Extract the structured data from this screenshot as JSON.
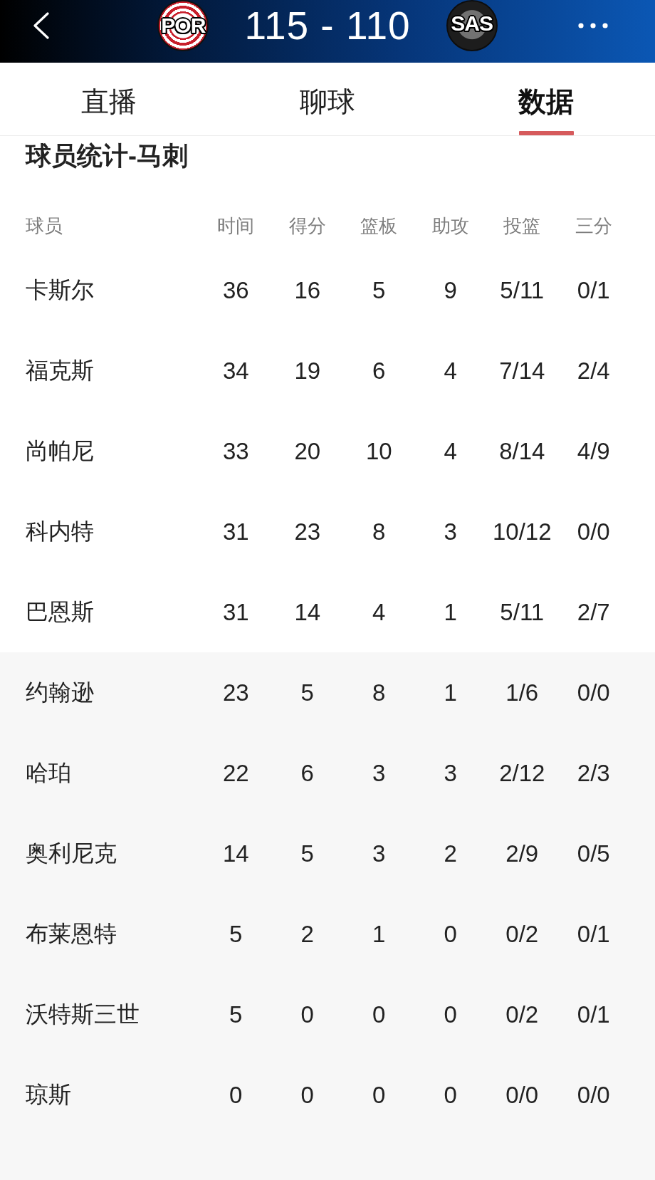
{
  "header": {
    "home": {
      "abbr": "POR"
    },
    "score": "115 - 110",
    "away": {
      "abbr": "SAS"
    }
  },
  "tabs": [
    {
      "label": "直播",
      "selected": false
    },
    {
      "label": "聊球",
      "selected": false
    },
    {
      "label": "数据",
      "selected": true
    }
  ],
  "section_title": "球员统计-马刺",
  "table": {
    "columns": [
      "球员",
      "时间",
      "得分",
      "篮板",
      "助攻",
      "投篮",
      "三分"
    ],
    "groups": [
      {
        "kind": "starters",
        "rows": [
          {
            "cells": [
              "卡斯尔",
              "36",
              "16",
              "5",
              "9",
              "5/11",
              "0/1"
            ]
          },
          {
            "cells": [
              "福克斯",
              "34",
              "19",
              "6",
              "4",
              "7/14",
              "2/4"
            ]
          },
          {
            "cells": [
              "尚帕尼",
              "33",
              "20",
              "10",
              "4",
              "8/14",
              "4/9"
            ]
          },
          {
            "cells": [
              "科内特",
              "31",
              "23",
              "8",
              "3",
              "10/12",
              "0/0"
            ]
          },
          {
            "cells": [
              "巴恩斯",
              "31",
              "14",
              "4",
              "1",
              "5/11",
              "2/7"
            ]
          }
        ]
      },
      {
        "kind": "bench",
        "rows": [
          {
            "cells": [
              "约翰逊",
              "23",
              "5",
              "8",
              "1",
              "1/6",
              "0/0"
            ]
          },
          {
            "cells": [
              "哈珀",
              "22",
              "6",
              "3",
              "3",
              "2/12",
              "2/3"
            ]
          },
          {
            "cells": [
              "奥利尼克",
              "14",
              "5",
              "3",
              "2",
              "2/9",
              "0/5"
            ]
          },
          {
            "cells": [
              "布莱恩特",
              "5",
              "2",
              "1",
              "0",
              "0/2",
              "0/1"
            ]
          },
          {
            "cells": [
              "沃特斯三世",
              "5",
              "0",
              "0",
              "0",
              "0/2",
              "0/1"
            ]
          },
          {
            "cells": [
              "琼斯",
              "0",
              "0",
              "0",
              "0",
              "0/0",
              "0/0"
            ]
          }
        ]
      }
    ]
  }
}
